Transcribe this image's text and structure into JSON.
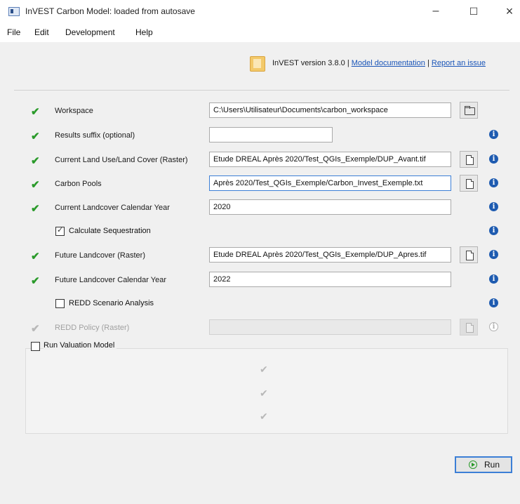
{
  "window": {
    "title": "InVEST Carbon Model: loaded from autosave",
    "minimize": "–",
    "maximize": "☐",
    "close": "×"
  },
  "menu": [
    "File",
    "Edit",
    "Development",
    "Help"
  ],
  "header": {
    "version": "InVEST version 3.8.0",
    "sep": "|",
    "doc_link": "Model documentation",
    "issue_link": "Report an issue"
  },
  "form": {
    "workspace": {
      "label": "Workspace",
      "value": "C:\\Users\\Utilisateur\\Documents\\carbon_workspace"
    },
    "suffix": {
      "label": "Results suffix (optional)",
      "value": ""
    },
    "lulc_cur": {
      "label": "Current Land Use/Land Cover (Raster)",
      "value": "Etude DREAL Après 2020/Test_QGIs_Exemple/DUP_Avant.tif"
    },
    "pools": {
      "label": "Carbon Pools",
      "value": "Après 2020/Test_QGIs_Exemple/Carbon_Invest_Exemple.txt"
    },
    "cur_year": {
      "label": "Current Landcover Calendar Year",
      "value": "2020"
    },
    "sequestration": {
      "label": "Calculate Sequestration",
      "checked": "✓"
    },
    "lulc_fut": {
      "label": "Future Landcover (Raster)",
      "value": "Etude DREAL Après 2020/Test_QGIs_Exemple/DUP_Apres.tif"
    },
    "fut_year": {
      "label": "Future Landcover Calendar Year",
      "value": "2022"
    },
    "redd": {
      "label": "REDD Scenario Analysis"
    },
    "redd_policy": {
      "label": "REDD Policy (Raster)",
      "value": ""
    },
    "valuation": {
      "label": "Run Valuation Model"
    }
  },
  "marks": {
    "check": "✔",
    "info": "i"
  },
  "run": {
    "label": "Run"
  },
  "colors": {
    "valid": "#2a9a2a",
    "info": "#1e5bb0",
    "link": "#1a55b8"
  }
}
